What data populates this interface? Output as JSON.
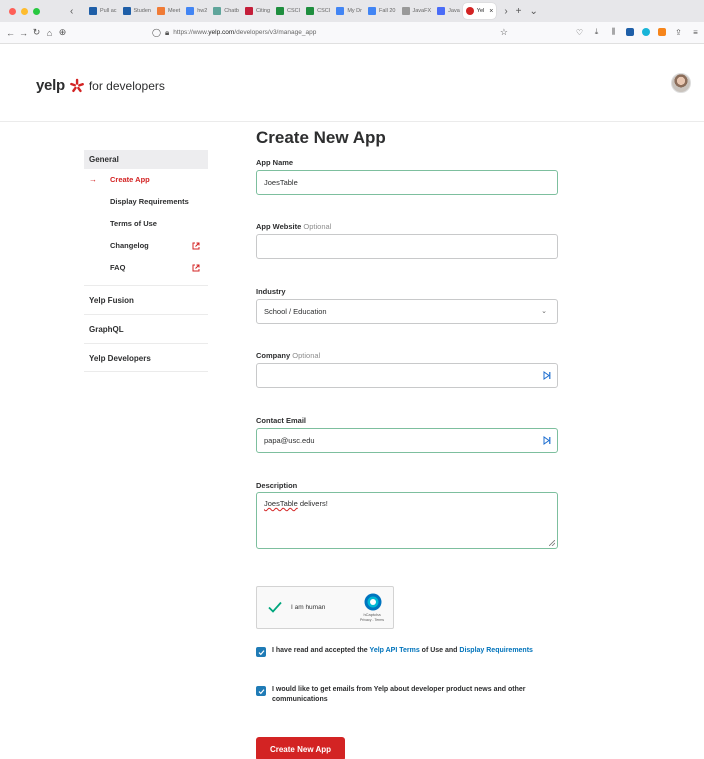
{
  "browser": {
    "tabs": [
      {
        "label": "Pull ac",
        "color": "#1f5fa8"
      },
      {
        "label": "Studen",
        "color": "#1f5fa8"
      },
      {
        "label": "Meet",
        "color": "#f07b36"
      },
      {
        "label": "hw2",
        "color": "#4285f4"
      },
      {
        "label": "Chatb",
        "color": "#5fa59b"
      },
      {
        "label": "Citing",
        "color": "#c41e3a"
      },
      {
        "label": "CSCI",
        "color": "#1e8e3e"
      },
      {
        "label": "CSCI",
        "color": "#1e8e3e"
      },
      {
        "label": "My Dr",
        "color": "#4285f4"
      },
      {
        "label": "Fall 20",
        "color": "#4285f4"
      },
      {
        "label": "JavaFX",
        "color": "#999999"
      },
      {
        "label": "Java",
        "color": "#4a6cf7"
      },
      {
        "label": "Yel",
        "color": "#d32323"
      }
    ],
    "active_tab_close": "×",
    "new_tab": "+",
    "tab_list": "⌄",
    "tabs_scroll": "›",
    "url_prefix": "https://www.",
    "url_domain": "yelp.com",
    "url_path": "/developers/v3/manage_app"
  },
  "header": {
    "logo_text": "yelp",
    "logo_suffix": "for developers"
  },
  "sidebar": {
    "group_label": "General",
    "items": [
      {
        "label": "Create App",
        "active": true,
        "external": false
      },
      {
        "label": "Display Requirements",
        "active": false,
        "external": false
      },
      {
        "label": "Terms of Use",
        "active": false,
        "external": false
      },
      {
        "label": "Changelog",
        "active": false,
        "external": true
      },
      {
        "label": "FAQ",
        "active": false,
        "external": true
      }
    ],
    "sections": [
      "Yelp Fusion",
      "GraphQL",
      "Yelp Developers"
    ]
  },
  "form": {
    "title": "Create New App",
    "app_name": {
      "label": "App Name",
      "value": "JoesTable"
    },
    "app_website": {
      "label": "App Website",
      "optional": "Optional",
      "value": ""
    },
    "industry": {
      "label": "Industry",
      "value": "School / Education"
    },
    "company": {
      "label": "Company",
      "optional": "Optional",
      "value": ""
    },
    "contact_email": {
      "label": "Contact Email",
      "value": "papa@usc.edu"
    },
    "description": {
      "label": "Description",
      "value_word": "JoesTable",
      "value_rest": " delivers!"
    },
    "captcha": {
      "label": "I am human",
      "brand": "hCaptcha",
      "links": "Privacy - Terms"
    },
    "terms": {
      "pre": "I have read and accepted the ",
      "link1": "Yelp API Terms",
      "mid": " of Use and ",
      "link2": "Display Requirements",
      "checked": true
    },
    "emails": {
      "text": "I would like to get emails from Yelp about developer product news and other communications",
      "checked": true
    },
    "submit_label": "Create New App"
  },
  "colors": {
    "brand_red": "#d32323",
    "link_blue": "#0073bb",
    "checkbox_blue": "#1f7bb6",
    "focus_green": "#7dbf9e"
  }
}
